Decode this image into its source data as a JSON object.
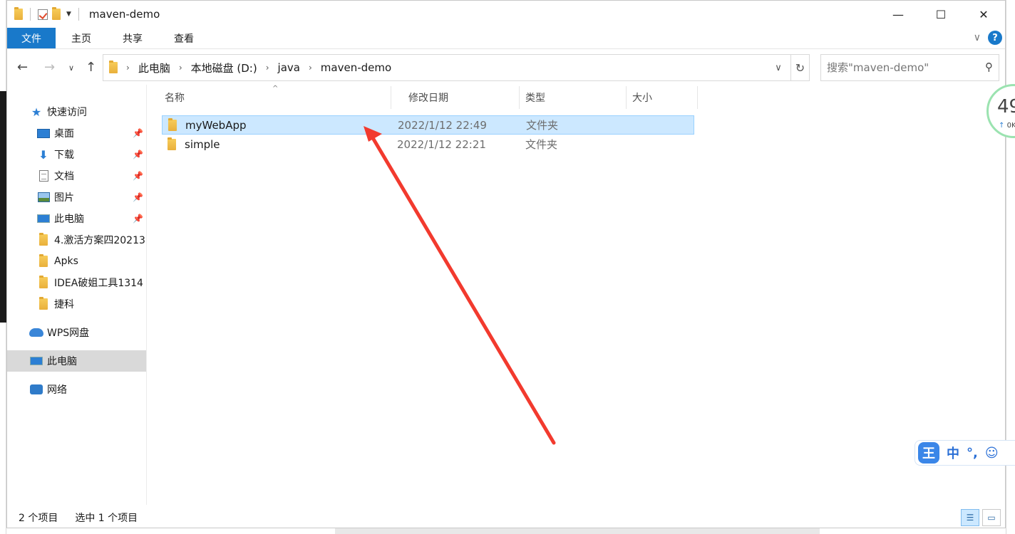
{
  "window": {
    "title": "maven-demo",
    "controls": {
      "minimize": "—",
      "maximize": "☐",
      "close": "✕"
    }
  },
  "ribbon": {
    "tabs": [
      "文件",
      "主页",
      "共享",
      "查看"
    ]
  },
  "nav": {
    "breadcrumbs": [
      "此电脑",
      "本地磁盘 (D:)",
      "java",
      "maven-demo"
    ],
    "search_placeholder": "搜索\"maven-demo\""
  },
  "sidebar": {
    "quick_access": "快速访问",
    "items": [
      {
        "label": "桌面",
        "icon": "desktop-icon",
        "pinned": true
      },
      {
        "label": "下载",
        "icon": "download-icon",
        "pinned": true
      },
      {
        "label": "文档",
        "icon": "document-icon",
        "pinned": true
      },
      {
        "label": "图片",
        "icon": "pictures-icon",
        "pinned": true
      },
      {
        "label": "此电脑",
        "icon": "computer-icon",
        "pinned": true
      },
      {
        "label": "4.激活方案四20213",
        "icon": "folder-icon",
        "pinned": false
      },
      {
        "label": "Apks",
        "icon": "folder-icon",
        "pinned": false
      },
      {
        "label": "IDEA破姐工具1314",
        "icon": "folder-icon",
        "pinned": false
      },
      {
        "label": "捷科",
        "icon": "folder-icon",
        "pinned": false
      }
    ],
    "wps": "WPS网盘",
    "this_pc": "此电脑",
    "network": "网络"
  },
  "columns": [
    "名称",
    "修改日期",
    "类型",
    "大小"
  ],
  "files": [
    {
      "name": "myWebApp",
      "date": "2022/1/12 22:49",
      "type": "文件夹",
      "selected": true
    },
    {
      "name": "simple",
      "date": "2022/1/12 22:21",
      "type": "文件夹",
      "selected": false
    }
  ],
  "status": {
    "item_count": "2 个项目",
    "selected_count": "选中 1 个项目"
  },
  "widgets": {
    "speed_value": "49",
    "speed_sub": "0K",
    "ime_logo": "王",
    "ime_mode": "中",
    "ime_punct": "°,",
    "ime_emoji": "☺"
  },
  "colors": {
    "file_tab": "#1979ca",
    "selection": "#cce8ff",
    "annotation_arrow": "#f23a2e"
  }
}
